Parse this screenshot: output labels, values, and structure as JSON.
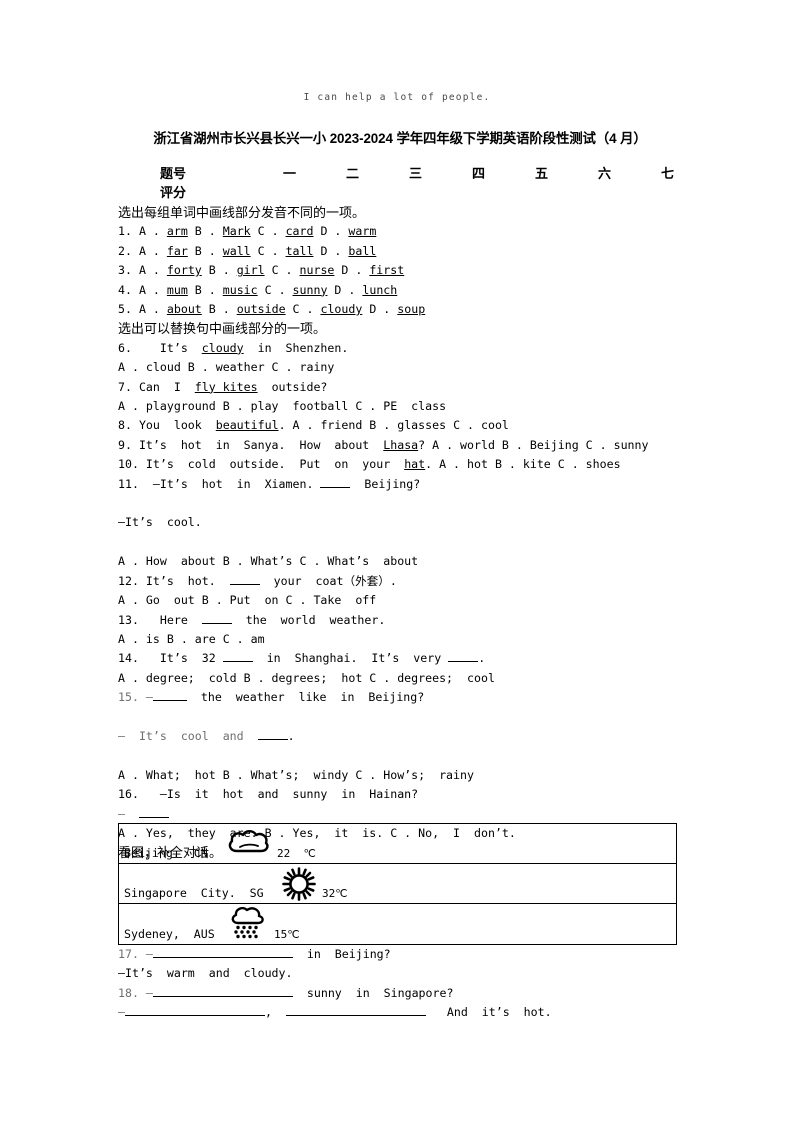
{
  "running_head": "I can help a lot of people.",
  "title": "浙江省湖州市长兴县长兴一小 2023-2024 学年四年级下学期英语阶段性测试（4 月）",
  "score_table": {
    "row_labels": [
      "题号",
      "评分"
    ],
    "columns": [
      "一",
      "二",
      "三",
      "四",
      "五",
      "六",
      "七"
    ],
    "scores": [
      "",
      "",
      "",
      "",
      "",
      "",
      ""
    ]
  },
  "sections": [
    {
      "id": "s1",
      "heading": "选出每组单词中画线部分发音不同的一项。"
    },
    {
      "id": "s2",
      "heading": "选出可以替换句中画线部分的一项。"
    },
    {
      "id": "s3",
      "heading": "看图，补全对话。"
    }
  ],
  "questions": {
    "q1": "1. A . arm B . Mark C . card D . warm",
    "q2": "2. A . far B . wall C . tall D . ball",
    "q3": "3. A . forty B . girl C . nurse D . first",
    "q4": "4. A . mum B . music C . sunny D . lunch",
    "q5": "5. A . about B . outside C . cloudy D . soup",
    "q6_stem": "6.    It’s  cloudy  in  Shenzhen.",
    "q6_opts": "A . cloud B . weather C . rainy",
    "q7_stem": "7. Can  I  fly kites  outside?",
    "q7_opts": "A . playground B . play  football C . PE  class",
    "q8": "8. You  look  beautiful. A . friend B . glasses C . cool",
    "q9": "9. It’s  hot  in  Sanya.  How  about  Lhasa? A . world B . Beijing C . sunny",
    "q10": "10. It’s  cold  outside.  Put  on  your  hat. A . hot B . kite C . shoes",
    "q11_stem_a": "11.  —It’s  hot  in  Xiamen.",
    "q11_stem_b": "Beijing?",
    "q11_answer": "—It’s  cool.",
    "q11_opts": "A . How  about B . What’s C . What’s  about",
    "q12_stem_a": "12. It’s  hot.",
    "q12_stem_b": "your  coat（外套）.",
    "q12_opts": "A . Go  out B . Put  on C . Take  off",
    "q13_stem_a": "13.   Here",
    "q13_stem_b": "the  world  weather.",
    "q13_opts": "A . is B . are C . am",
    "q14_stem_a": "14.   It’s  32",
    "q14_stem_b": "in  Shanghai.  It’s  very",
    "q14_stem_c": ".",
    "q14_opts": "A . degree;  cold B . degrees;  hot C . degrees;  cool",
    "q15_stem_a": "15. —",
    "q15_stem_b": "the  weather  like  in  Beijing?",
    "q15_answer_a": "—  It’s  cool  and",
    "q15_answer_b": ".",
    "q15_opts": "A . What;  hot B . What’s;  windy C . How’s;  rainy",
    "q16_stem": "16.   —Is  it  hot  and  sunny  in  Hainan?",
    "q16_answer": "—",
    "q16_opts": "A . Yes,  they  are. B . Yes,  it  is. C . No,  I  don’t.",
    "q17_a": "17. —",
    "q17_b": "in  Beijing?",
    "q17_answer": "—It’s  warm  and  cloudy.",
    "q18_a": "18. —",
    "q18_b": "sunny  in  Singapore?",
    "q18_answer_a": "—",
    "q18_answer_b": ",",
    "q18_answer_c": "And  it’s  hot."
  },
  "weather_table": {
    "rows": [
      {
        "place": "Beijing.  CN",
        "icon": "cloudy-icon",
        "temp": "22  ℃"
      },
      {
        "place": "Singapore  City.  SG",
        "icon": "sunny-icon",
        "temp": "32℃"
      },
      {
        "place": "Sydeney,  AUS",
        "icon": "rainy-icon",
        "temp": "15℃"
      }
    ]
  },
  "colors": {
    "text": "#000000",
    "dash": "#6f6f6f",
    "runhead": "#4a4a4a",
    "rule": "#000000"
  }
}
